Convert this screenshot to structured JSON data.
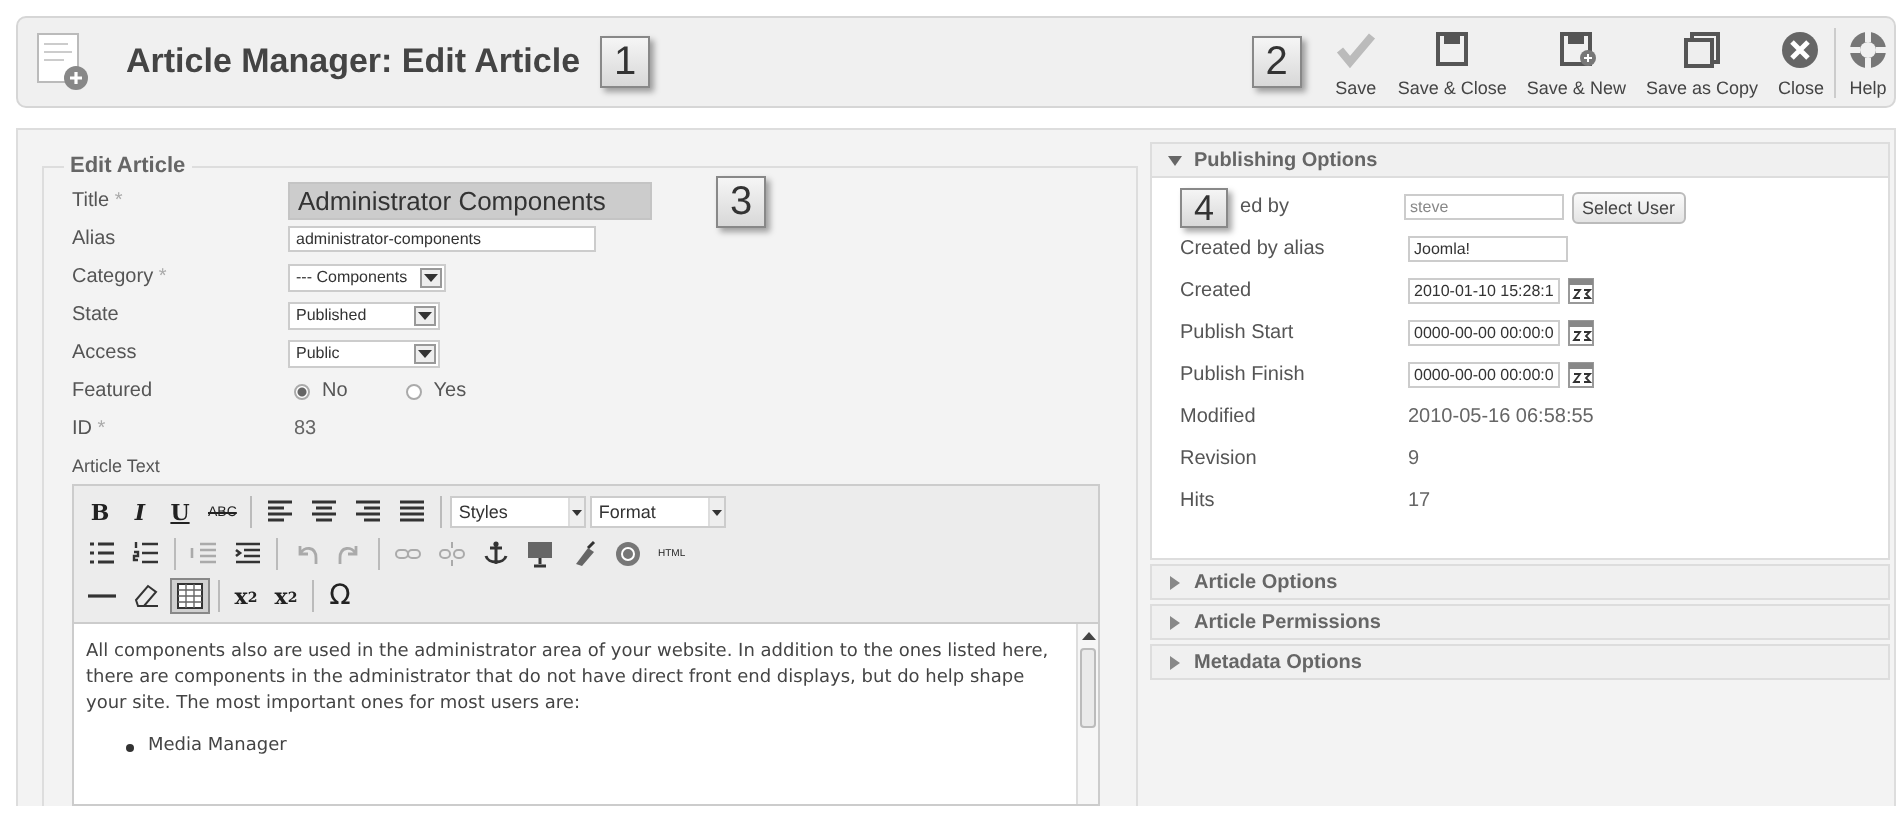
{
  "header": {
    "title": "Article Manager: Edit Article",
    "callout": "1"
  },
  "toolbar": {
    "callout": "2",
    "buttons": [
      {
        "kind": "check",
        "label": "Save"
      },
      {
        "kind": "disk",
        "label": "Save & Close"
      },
      {
        "kind": "disk-plus",
        "label": "Save & New"
      },
      {
        "kind": "disk-copy",
        "label": "Save as Copy"
      },
      {
        "kind": "close",
        "label": "Close"
      },
      {
        "kind": "help",
        "label": "Help"
      }
    ]
  },
  "edit_article": {
    "legend": "Edit Article",
    "callout": "3",
    "fields": [
      {
        "kind": "title",
        "label": "Title",
        "required_mark": "*",
        "value": "Administrator Components"
      },
      {
        "kind": "text",
        "label": "Alias",
        "value": "administrator-components"
      },
      {
        "kind": "select",
        "label": "Category",
        "required_mark": "*",
        "value": "--- Components"
      },
      {
        "kind": "select",
        "label": "State",
        "value": "Published"
      },
      {
        "kind": "select",
        "label": "Access",
        "value": "Public"
      },
      {
        "kind": "radio",
        "label": "Featured",
        "options": [
          {
            "label": "No",
            "selected": true
          },
          {
            "label": "Yes",
            "selected": false
          }
        ]
      },
      {
        "kind": "static",
        "label": "ID",
        "required_mark": "*",
        "value": "83"
      }
    ]
  },
  "editor": {
    "label": "Article Text",
    "rows": [
      [
        [
          {
            "kind": "bold",
            "label": "B",
            "disabled": false,
            "selected": false
          },
          {
            "kind": "italic",
            "label": "I",
            "disabled": false,
            "selected": false
          },
          {
            "kind": "underline",
            "label": "U",
            "disabled": false,
            "selected": false
          },
          {
            "kind": "strike",
            "label": "ABC",
            "disabled": false,
            "selected": false
          }
        ],
        [
          {
            "kind": "align-left",
            "disabled": false,
            "selected": false
          },
          {
            "kind": "align-center",
            "disabled": false,
            "selected": false
          },
          {
            "kind": "align-right",
            "disabled": false,
            "selected": false
          },
          {
            "kind": "align-justify",
            "disabled": false,
            "selected": false
          }
        ],
        [
          {
            "kind": "dropdown",
            "label": "Styles"
          },
          {
            "kind": "dropdown",
            "label": "Format"
          }
        ]
      ],
      [
        [
          {
            "kind": "bullets",
            "disabled": false,
            "selected": false
          },
          {
            "kind": "numbers",
            "disabled": false,
            "selected": false
          }
        ],
        [
          {
            "kind": "outdent",
            "disabled": true,
            "selected": false
          },
          {
            "kind": "indent",
            "disabled": false,
            "selected": false
          }
        ],
        [
          {
            "kind": "undo",
            "disabled": true,
            "selected": false
          },
          {
            "kind": "redo",
            "disabled": true,
            "selected": false
          }
        ],
        [
          {
            "kind": "link",
            "disabled": true,
            "selected": false
          },
          {
            "kind": "unlink",
            "disabled": true,
            "selected": false
          },
          {
            "kind": "anchor",
            "disabled": false,
            "selected": false
          },
          {
            "kind": "image",
            "disabled": false,
            "selected": false
          },
          {
            "kind": "cleanup",
            "disabled": false,
            "selected": false
          },
          {
            "kind": "help",
            "disabled": false,
            "selected": false
          },
          {
            "kind": "html",
            "label": "HTML",
            "disabled": false,
            "selected": false
          }
        ]
      ],
      [
        [
          {
            "kind": "rule",
            "disabled": false,
            "selected": false
          },
          {
            "kind": "eraser",
            "disabled": false,
            "selected": false
          },
          {
            "kind": "table",
            "disabled": false,
            "selected": true
          }
        ],
        [
          {
            "kind": "sub",
            "label": "x",
            "mark": "$_{2}$",
            "disabled": false,
            "selected": false
          },
          {
            "kind": "sup",
            "label": "x",
            "mark": "$^{2}$",
            "disabled": false,
            "selected": false
          }
        ],
        [
          {
            "kind": "omega",
            "label": "Ω",
            "disabled": false,
            "selected": false
          }
        ]
      ]
    ],
    "paragraph": "All components also are used in the administrator area of your website. In addition to the ones listed here, there are components in the administrator that do not have direct front end displays, but do help shape your site. The most important ones for most users are:",
    "list": [
      "Media Manager"
    ]
  },
  "publishing": {
    "title": "Publishing Options",
    "expanded": true,
    "callout": "4",
    "rows": [
      {
        "kind": "user",
        "label": "ed by",
        "value": "steve",
        "button": "Select User"
      },
      {
        "kind": "text",
        "label": "Created by alias",
        "value": "Joomla!"
      },
      {
        "kind": "date",
        "label": "Created",
        "value": "2010-01-10 15:28:1"
      },
      {
        "kind": "date",
        "label": "Publish Start",
        "value": "0000-00-00 00:00:0"
      },
      {
        "kind": "date",
        "label": "Publish Finish",
        "value": "0000-00-00 00:00:0"
      },
      {
        "kind": "static",
        "label": "Modified",
        "value": "2010-05-16 06:58:55"
      },
      {
        "kind": "static",
        "label": "Revision",
        "value": "9"
      },
      {
        "kind": "static",
        "label": "Hits",
        "value": "17"
      }
    ]
  },
  "panels": [
    {
      "title": "Article Options",
      "expanded": false
    },
    {
      "title": "Article Permissions",
      "expanded": false
    },
    {
      "title": "Metadata Options",
      "expanded": false
    }
  ]
}
